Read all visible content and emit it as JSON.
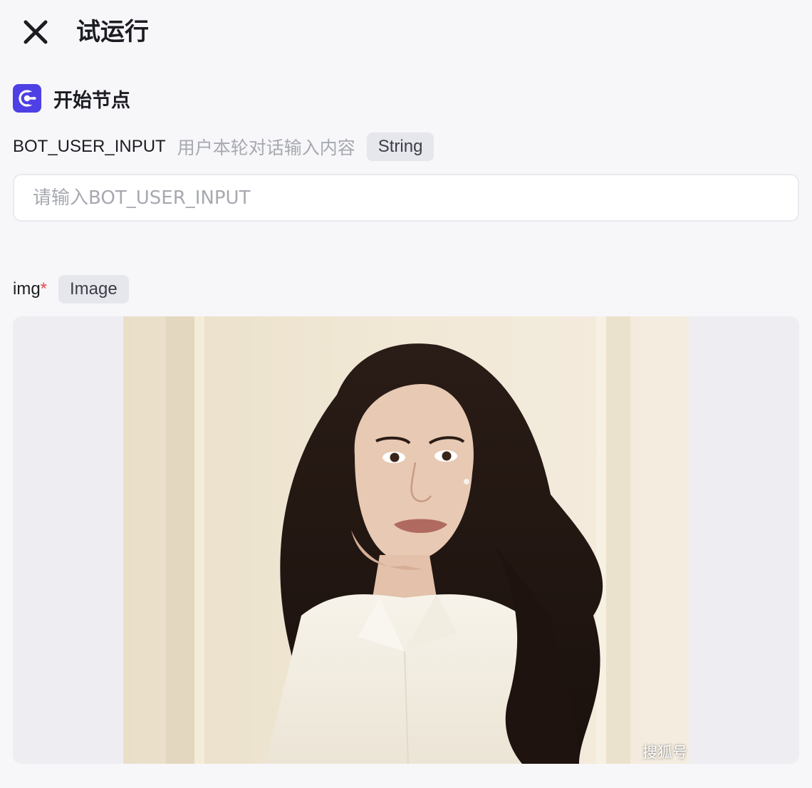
{
  "header": {
    "title": "试运行",
    "close_icon": "close-icon"
  },
  "node": {
    "icon": "start-node-icon",
    "title": "开始节点",
    "accent_color": "#4e40e5"
  },
  "params": {
    "bot_user_input": {
      "name": "BOT_USER_INPUT",
      "description": "用户本轮对话输入内容",
      "type": "String",
      "value": "",
      "placeholder": "请输入BOT_USER_INPUT"
    },
    "img": {
      "name": "img",
      "required_mark": "*",
      "type": "Image",
      "watermark": "搜狐号"
    }
  }
}
